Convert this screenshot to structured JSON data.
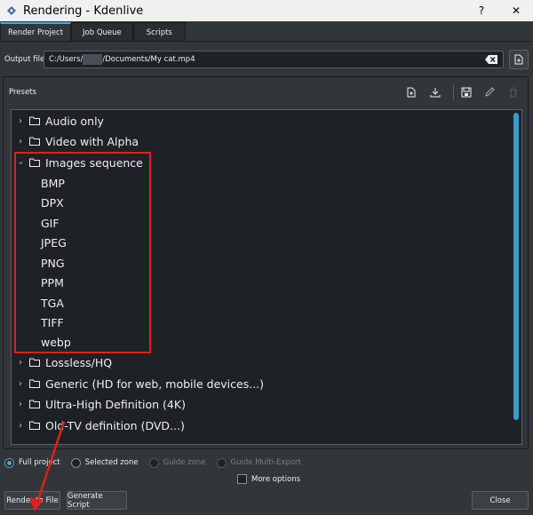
{
  "window": {
    "title": "Rendering - Kdenlive",
    "help_label": "?",
    "close_label": "✕"
  },
  "tabs": [
    {
      "label": "Render Project"
    },
    {
      "label": "Job Queue"
    },
    {
      "label": "Scripts"
    }
  ],
  "output": {
    "label": "Output file",
    "path_prefix": "C:/Users/",
    "path_suffix": "/Documents/My cat.mp4"
  },
  "presets": {
    "label": "Presets",
    "tree": [
      {
        "label": "Audio only",
        "expanded": false
      },
      {
        "label": "Video with Alpha",
        "expanded": false
      },
      {
        "label": "Images sequence",
        "expanded": true
      },
      {
        "label": "BMP"
      },
      {
        "label": "DPX"
      },
      {
        "label": "GIF"
      },
      {
        "label": "JPEG"
      },
      {
        "label": "PNG"
      },
      {
        "label": "PPM"
      },
      {
        "label": "TGA"
      },
      {
        "label": "TIFF"
      },
      {
        "label": "webp"
      },
      {
        "label": "Lossless/HQ",
        "expanded": false
      },
      {
        "label": "Generic (HD for web, mobile devices...)",
        "expanded": false
      },
      {
        "label": "Ultra-High Definition (4K)",
        "expanded": false
      },
      {
        "label": "Old-TV definition (DVD...)",
        "expanded": false
      }
    ]
  },
  "zones": {
    "full_project": "Full project",
    "selected_zone": "Selected zone",
    "guide_zone": "Guide zone",
    "guide_multi_export": "Guide Multi-Export"
  },
  "more_options": "More options",
  "buttons": {
    "render_to_file": "Render to File",
    "generate_script": "Generate Script",
    "close": "Close"
  },
  "colors": {
    "accent": "#3daee9",
    "highlight_box": "#e0201c",
    "background": "#31363b"
  }
}
